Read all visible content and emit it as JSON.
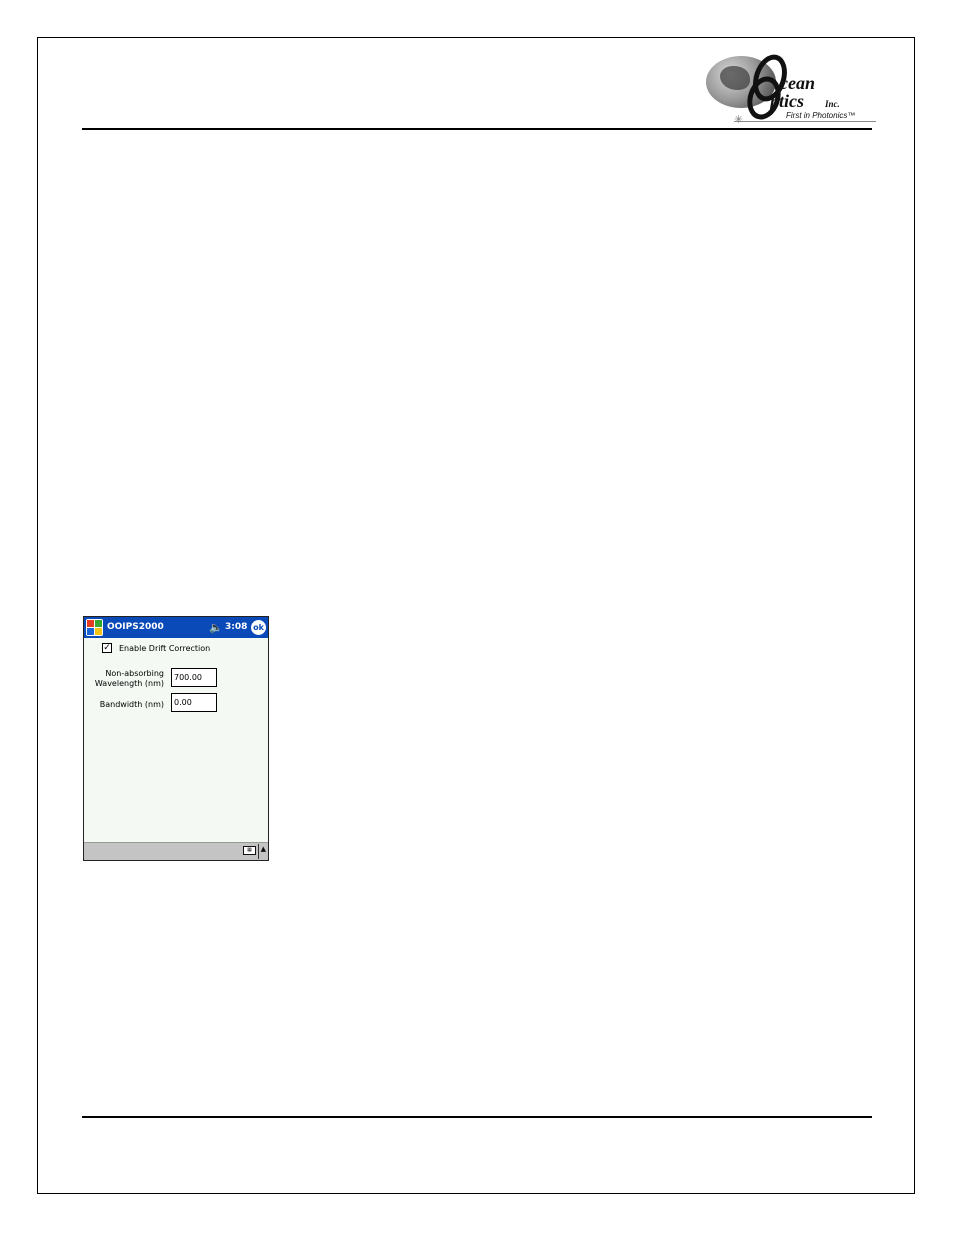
{
  "logo": {
    "line1": "cean",
    "line2": "ptics",
    "suffix": "Inc.",
    "tagline": "First in Photonics™"
  },
  "screenshot": {
    "title": "OOIPS2000",
    "time": "3:08",
    "ok_label": "ok",
    "speaker_glyph": "🔈",
    "checkbox": {
      "label": "Enable Drift Correction",
      "checked": true,
      "mark": "✓"
    },
    "fields": [
      {
        "label": "Non-absorbing Wavelength (nm)",
        "value": "700.00"
      },
      {
        "label": "Bandwidth (nm)",
        "value": "0.00"
      }
    ],
    "keyboard_glyph": "▦",
    "sip_arrow": "▲"
  }
}
